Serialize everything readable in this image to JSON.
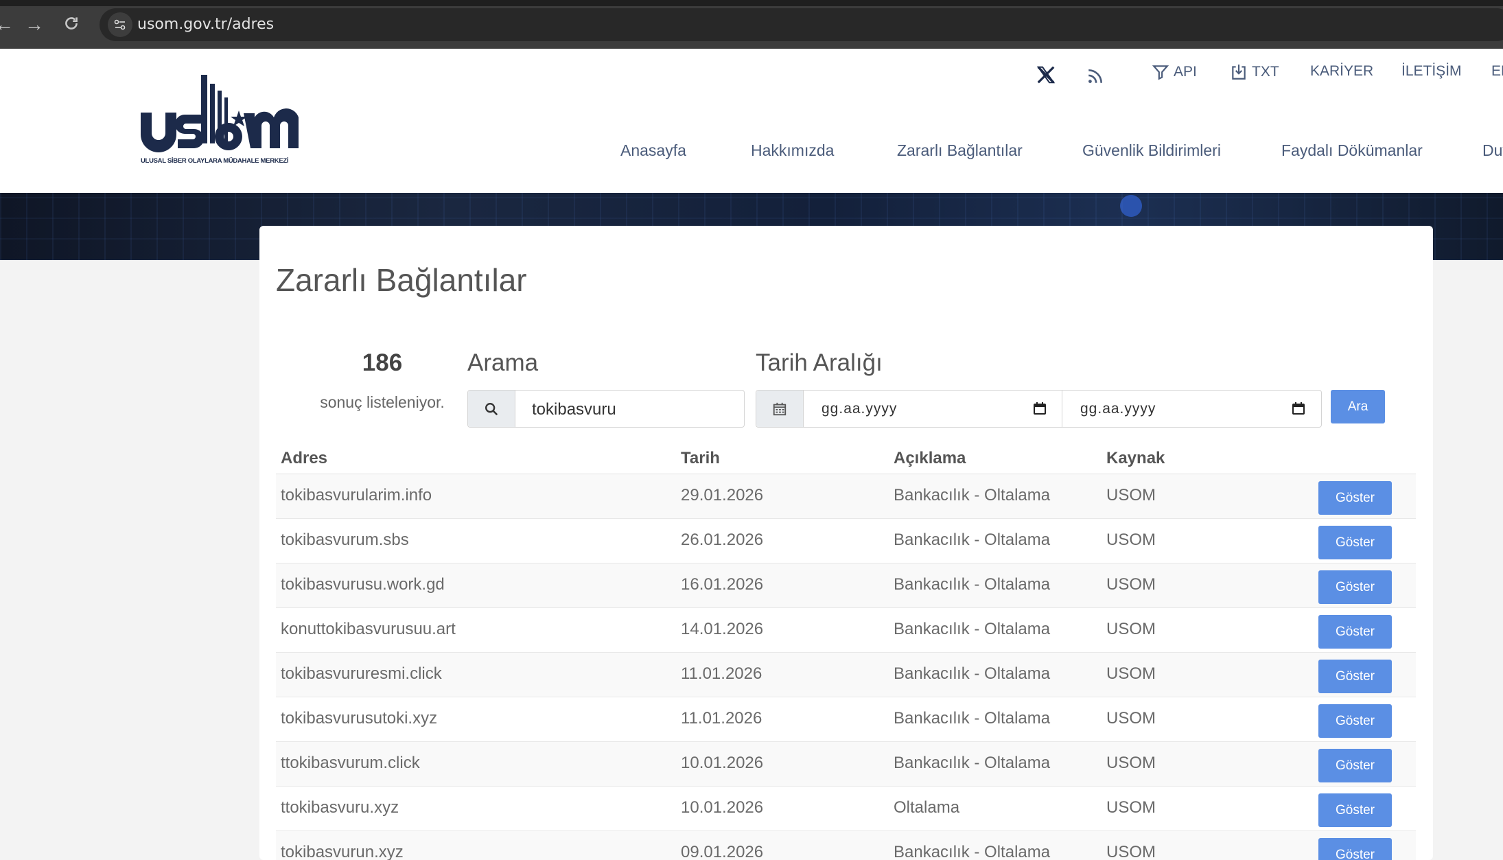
{
  "browser": {
    "url": "usom.gov.tr/adres",
    "back_icon": "arrow-left-icon",
    "forward_icon": "arrow-right-icon",
    "reload_icon": "reload-icon"
  },
  "header": {
    "logo_alt": "USOM - Ulusal Siber Olaylara Müdahale Merkezi",
    "utility": {
      "api": "API",
      "txt": "TXT",
      "kariyer": "KARİYER",
      "iletisim": "İLETİŞİM",
      "lang": "EN"
    },
    "nav": {
      "anasayfa": "Anasayfa",
      "hakkimizda": "Hakkımızda",
      "zararli": "Zararlı Bağlantılar",
      "guvenlik": "Güvenlik Bildirimleri",
      "faydali": "Faydalı Dökümanlar",
      "duyurular": "Duyurular"
    }
  },
  "page": {
    "title": "Zararlı Bağlantılar",
    "count": "186",
    "count_label": "sonuç listeleniyor.",
    "search_label": "Arama",
    "search_value": "tokibasvuru",
    "date_label": "Tarih Aralığı",
    "date_start_placeholder": "gg.aa.yyyy",
    "date_end_placeholder": "gg.aa.yyyy",
    "search_button": "Ara"
  },
  "table": {
    "headers": {
      "adres": "Adres",
      "tarih": "Tarih",
      "aciklama": "Açıklama",
      "kaynak": "Kaynak"
    },
    "button_label": "Göster",
    "rows": [
      {
        "adres": "tokibasvurularim.info",
        "tarih": "29.01.2026",
        "aciklama": "Bankacılık - Oltalama",
        "kaynak": "USOM"
      },
      {
        "adres": "tokibasvurum.sbs",
        "tarih": "26.01.2026",
        "aciklama": "Bankacılık - Oltalama",
        "kaynak": "USOM"
      },
      {
        "adres": "tokibasvurusu.work.gd",
        "tarih": "16.01.2026",
        "aciklama": "Bankacılık - Oltalama",
        "kaynak": "USOM"
      },
      {
        "adres": "konuttokibasvurusuu.art",
        "tarih": "14.01.2026",
        "aciklama": "Bankacılık - Oltalama",
        "kaynak": "USOM"
      },
      {
        "adres": "tokibasvururesmi.click",
        "tarih": "11.01.2026",
        "aciklama": "Bankacılık - Oltalama",
        "kaynak": "USOM"
      },
      {
        "adres": "tokibasvurusutoki.xyz",
        "tarih": "11.01.2026",
        "aciklama": "Bankacılık - Oltalama",
        "kaynak": "USOM"
      },
      {
        "adres": "ttokibasvurum.click",
        "tarih": "10.01.2026",
        "aciklama": "Bankacılık - Oltalama",
        "kaynak": "USOM"
      },
      {
        "adres": "ttokibasvuru.xyz",
        "tarih": "10.01.2026",
        "aciklama": "Oltalama",
        "kaynak": "USOM"
      },
      {
        "adres": "tokibasvurun.xyz",
        "tarih": "09.01.2026",
        "aciklama": "Bankacılık - Oltalama",
        "kaynak": "USOM"
      }
    ]
  },
  "colors": {
    "primary_button": "#5b8fe4",
    "nav_text": "#4a5b7a",
    "logo": "#1c2a4a"
  }
}
